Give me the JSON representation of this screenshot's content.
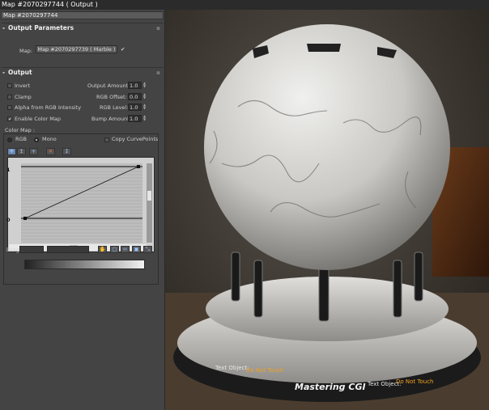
{
  "window": {
    "title": "Map #2070297744  ( Output )"
  },
  "name_field": {
    "value": "Map #2070297744"
  },
  "output_parameters": {
    "header": "Output Parameters",
    "map_label": "Map:",
    "map_button": "Map #2070297739  ( Marble )"
  },
  "output": {
    "header": "Output",
    "invert": {
      "label": "Invert",
      "checked": false
    },
    "clamp": {
      "label": "Clamp",
      "checked": false
    },
    "alpha_from_rgb": {
      "label": "Alpha from RGB Intensity",
      "checked": false
    },
    "enable_color_map": {
      "label": "Enable Color Map",
      "checked": true
    },
    "output_amount": {
      "label": "Output Amount:",
      "value": "1.0"
    },
    "rgb_offset": {
      "label": "RGB Offset:",
      "value": "0.0"
    },
    "rgb_level": {
      "label": "RGB Level:",
      "value": "1.0"
    },
    "bump_amount": {
      "label": "Bump Amount:",
      "value": "1.0"
    }
  },
  "color_map": {
    "label": "Color Map :",
    "rgb_label": "RGB",
    "mono_label": "Mono",
    "mode": "Mono",
    "copy_curvepoints_label": "Copy CurvePoints",
    "y_top_label": "1",
    "y_bottom_label": "0",
    "status_label": "Drag",
    "curve_points": [
      [
        0,
        0
      ],
      [
        1,
        1
      ]
    ]
  },
  "viewport": {
    "text_object": "Text Object:",
    "do_not_touch": "Do Not Touch",
    "logo_text": "Mastering CGI"
  },
  "colors": {
    "panel_bg": "#444444",
    "curve_bg": "#c8c8c8",
    "accent_blue": "#9cc6ff",
    "logo_orange": "#f0a020"
  }
}
